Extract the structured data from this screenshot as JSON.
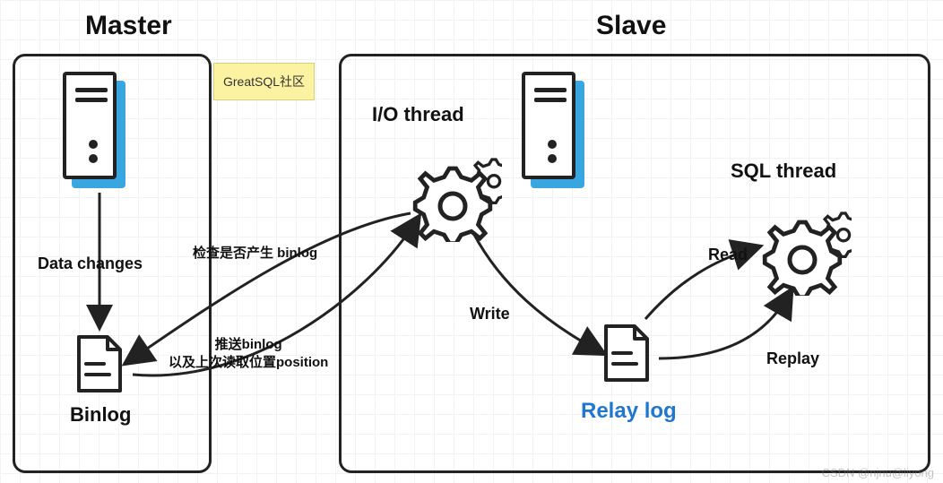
{
  "titles": {
    "master": "Master",
    "slave": "Slave"
  },
  "badge": "GreatSQL社区",
  "labels": {
    "data_changes": "Data changes",
    "binlog": "Binlog",
    "io_thread": "I/O thread",
    "sql_thread": "SQL thread",
    "relay_log": "Relay log",
    "write": "Write",
    "read": "Read",
    "replay": "Replay"
  },
  "annotations": {
    "check_binlog": "检查是否产生 binlog",
    "push_binlog": "推送binlog\n以及上次读取位置position"
  },
  "watermark": "CSDN @njnu@liyong",
  "colors": {
    "accent": "#3aa6e0",
    "blue_text": "#1f77d0",
    "stroke": "#222222",
    "badge_bg": "#fcf3a2"
  }
}
